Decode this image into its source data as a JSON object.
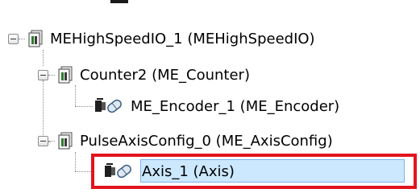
{
  "tree": {
    "items": [
      {
        "label": "MEHighSpeedIO_1 (MEHighSpeedIO)",
        "icon": "module-icon",
        "expanded": true
      },
      {
        "label": "Counter2 (ME_Counter)",
        "icon": "module-icon",
        "expanded": true
      },
      {
        "label": "ME_Encoder_1 (ME_Encoder)",
        "icon": "encoder-axis-icon"
      },
      {
        "label": "PulseAxisConfig_0 (ME_AxisConfig)",
        "icon": "module-icon",
        "expanded": true
      },
      {
        "label": "Axis_1 (Axis)",
        "icon": "encoder-axis-icon",
        "selected": true
      }
    ]
  },
  "colors": {
    "selection_fill": "#cce8ff",
    "selection_border": "#7eb4ea",
    "callout_border": "#e3141c"
  }
}
